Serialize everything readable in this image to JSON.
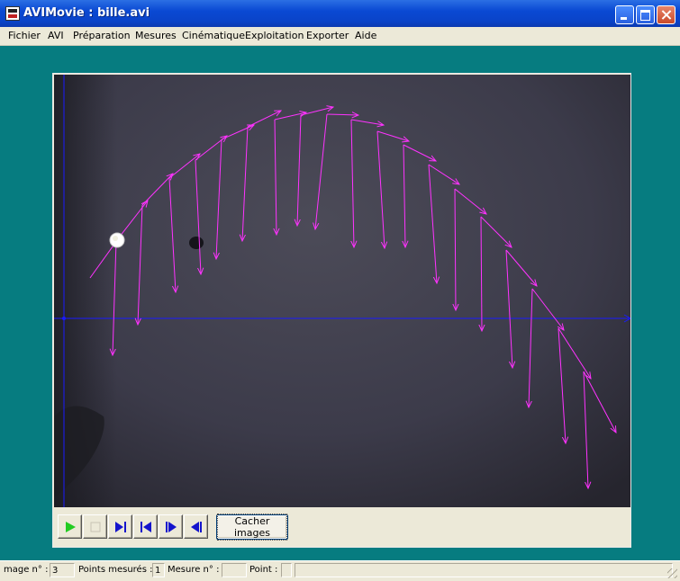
{
  "window": {
    "title": "AVIMovie : bille.avi",
    "accent": "#0a49d3",
    "background": "#067c80"
  },
  "menu": {
    "items": [
      "Fichier",
      "AVI",
      "Préparation",
      "Mesures",
      "Cinématique",
      "Exploitation",
      "Exporter",
      "Aide"
    ]
  },
  "video": {
    "trajectory_color": "#ff33ff",
    "axis_color": "#1a1aff",
    "ball_color": "#ffffff"
  },
  "controls": {
    "buttons": [
      "play",
      "stop",
      "next-frame",
      "first-frame",
      "step-forward",
      "last-frame"
    ],
    "hide_images_label": "Cacher images"
  },
  "status": {
    "image_label": "mage n° :",
    "image_value": "3",
    "points_label": "Points mesurés :",
    "points_value": "1",
    "mesure_label": "Mesure n° :",
    "mesure_value": "",
    "point_label": "Point :",
    "point_value": ""
  }
}
